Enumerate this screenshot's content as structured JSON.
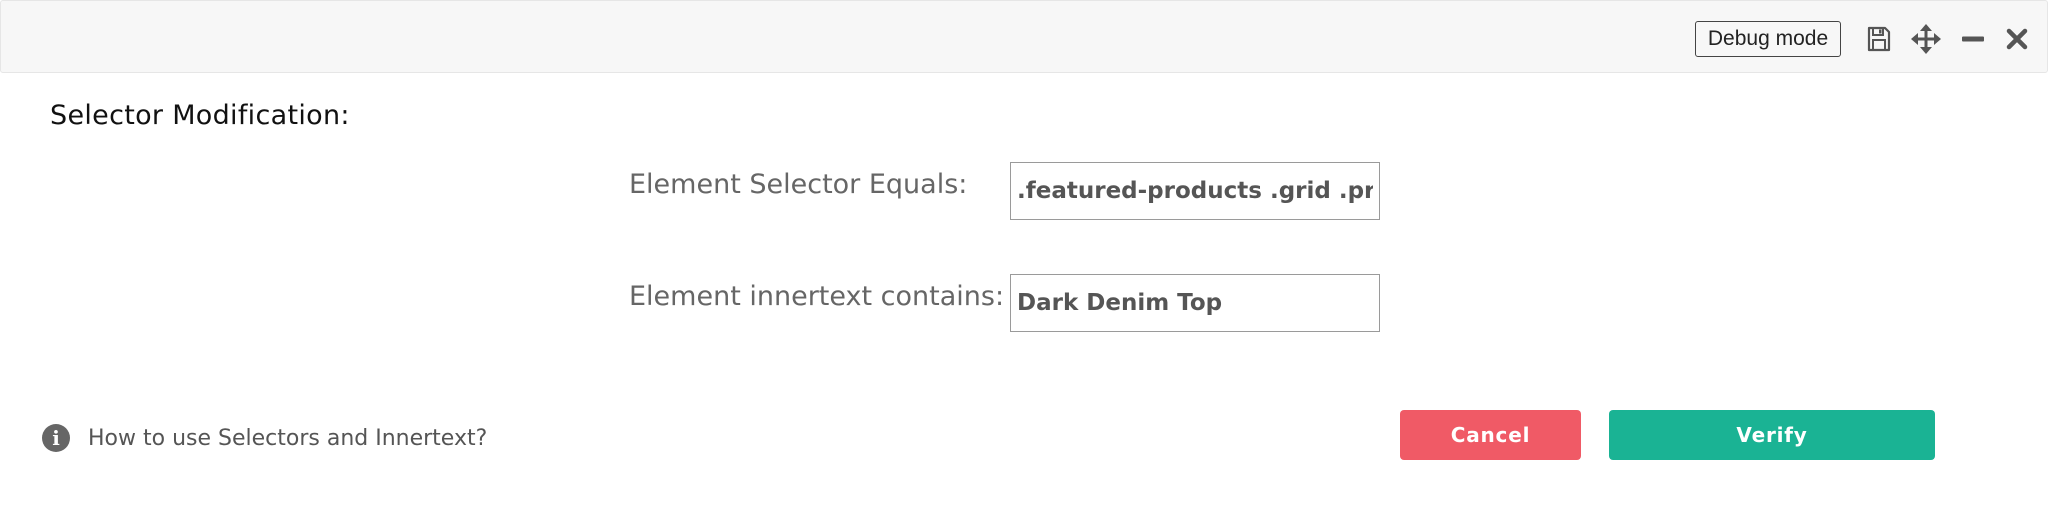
{
  "toolbar": {
    "debug_label": "Debug mode",
    "icons": [
      "save-icon",
      "move-icon",
      "minimize-icon",
      "close-icon"
    ]
  },
  "section": {
    "title": "Selector Modification:"
  },
  "fields": {
    "selector_label": "Element Selector Equals:",
    "selector_value": ".featured-products .grid .product",
    "innertext_label": "Element innertext contains:",
    "innertext_value": "Dark Denim Top"
  },
  "help": {
    "text": "How to use Selectors and Innertext?"
  },
  "actions": {
    "cancel_label": "Cancel",
    "verify_label": "Verify"
  },
  "colors": {
    "cancel": "#f05a66",
    "verify": "#1ab394",
    "toolbar_bg": "#f7f7f7",
    "label_text": "#666666"
  }
}
